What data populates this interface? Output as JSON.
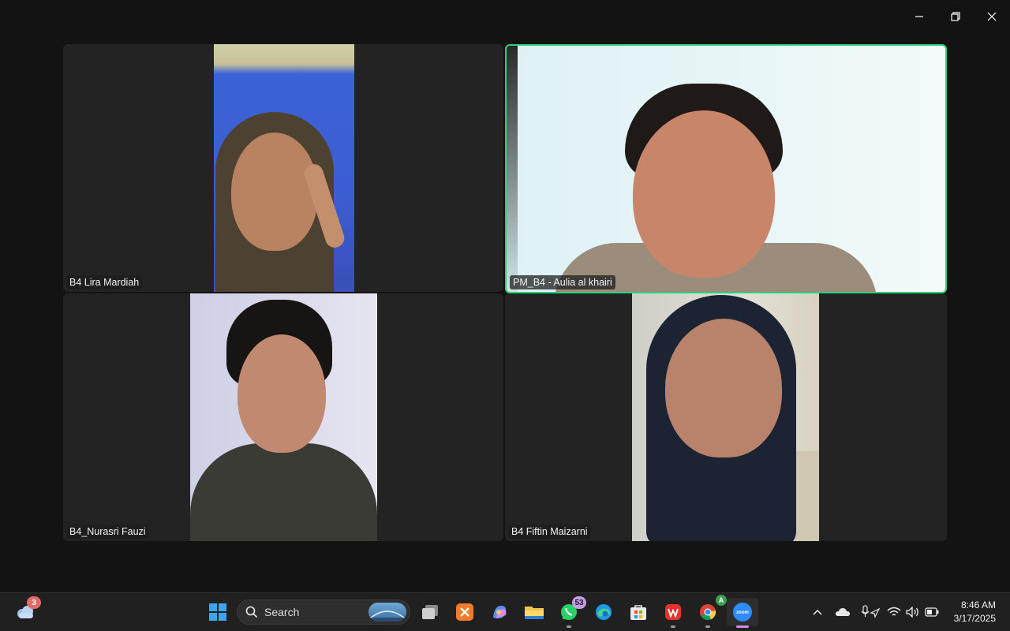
{
  "window_controls": {
    "minimize": "minimize",
    "restore": "restore",
    "close": "close"
  },
  "participants": [
    {
      "name": "B4 Lira Mardiah",
      "speaking": false
    },
    {
      "name": "PM_B4 - Aulia al khairi",
      "speaking": true
    },
    {
      "name": "B4_Nurasri Fauzi",
      "speaking": false
    },
    {
      "name": "B4 Fiftin Maizarni",
      "speaking": false
    }
  ],
  "colors": {
    "active_speaker_border": "#2bd07a",
    "tile_bg": "#232323",
    "page_bg": "#131313"
  },
  "taskbar": {
    "weather_badge": "3",
    "search_placeholder": "Search",
    "whatsapp_badge": "53",
    "chrome_profile": "A",
    "zoom_label": "zoom",
    "apps": [
      "start",
      "search",
      "task-view",
      "xampp",
      "copilot",
      "file-explorer",
      "whatsapp",
      "edge",
      "microsoft-store",
      "wps-office",
      "chrome",
      "zoom"
    ],
    "tray": [
      "show-hidden-icons",
      "onedrive",
      "microphone-location",
      "wifi",
      "volume",
      "battery"
    ]
  },
  "clock": {
    "time": "8:46 AM",
    "date": "3/17/2025"
  }
}
